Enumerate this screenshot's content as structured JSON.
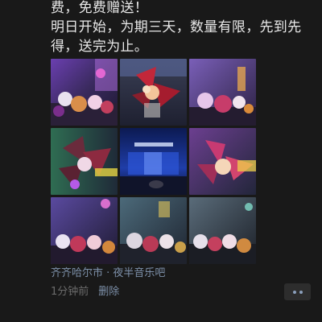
{
  "post": {
    "text_lines": [
      "费，免费赠送！",
      "明日开始，为期三天，数量有限，先到先",
      "得，送完为止。"
    ],
    "photos": [
      {
        "name": "photo-bar-flowers-purple"
      },
      {
        "name": "photo-bouquet-red-bow"
      },
      {
        "name": "photo-bar-bouquets-neon"
      },
      {
        "name": "photo-bouquet-green-light"
      },
      {
        "name": "photo-stage-blue"
      },
      {
        "name": "photo-bouquet-pink-bow"
      },
      {
        "name": "photo-bar-bouquets-violet"
      },
      {
        "name": "photo-bar-bouquets-teal"
      },
      {
        "name": "photo-bar-bouquets-dim"
      }
    ],
    "location": "齐齐哈尔市 · 夜半音乐吧",
    "time": "1分钟前",
    "delete_label": "删除",
    "more_icon": "more-dots-icon"
  },
  "colors": {
    "background": "#191919",
    "text": "#e8e8e8",
    "link": "#7d90a9",
    "muted": "#6b6b6b"
  }
}
